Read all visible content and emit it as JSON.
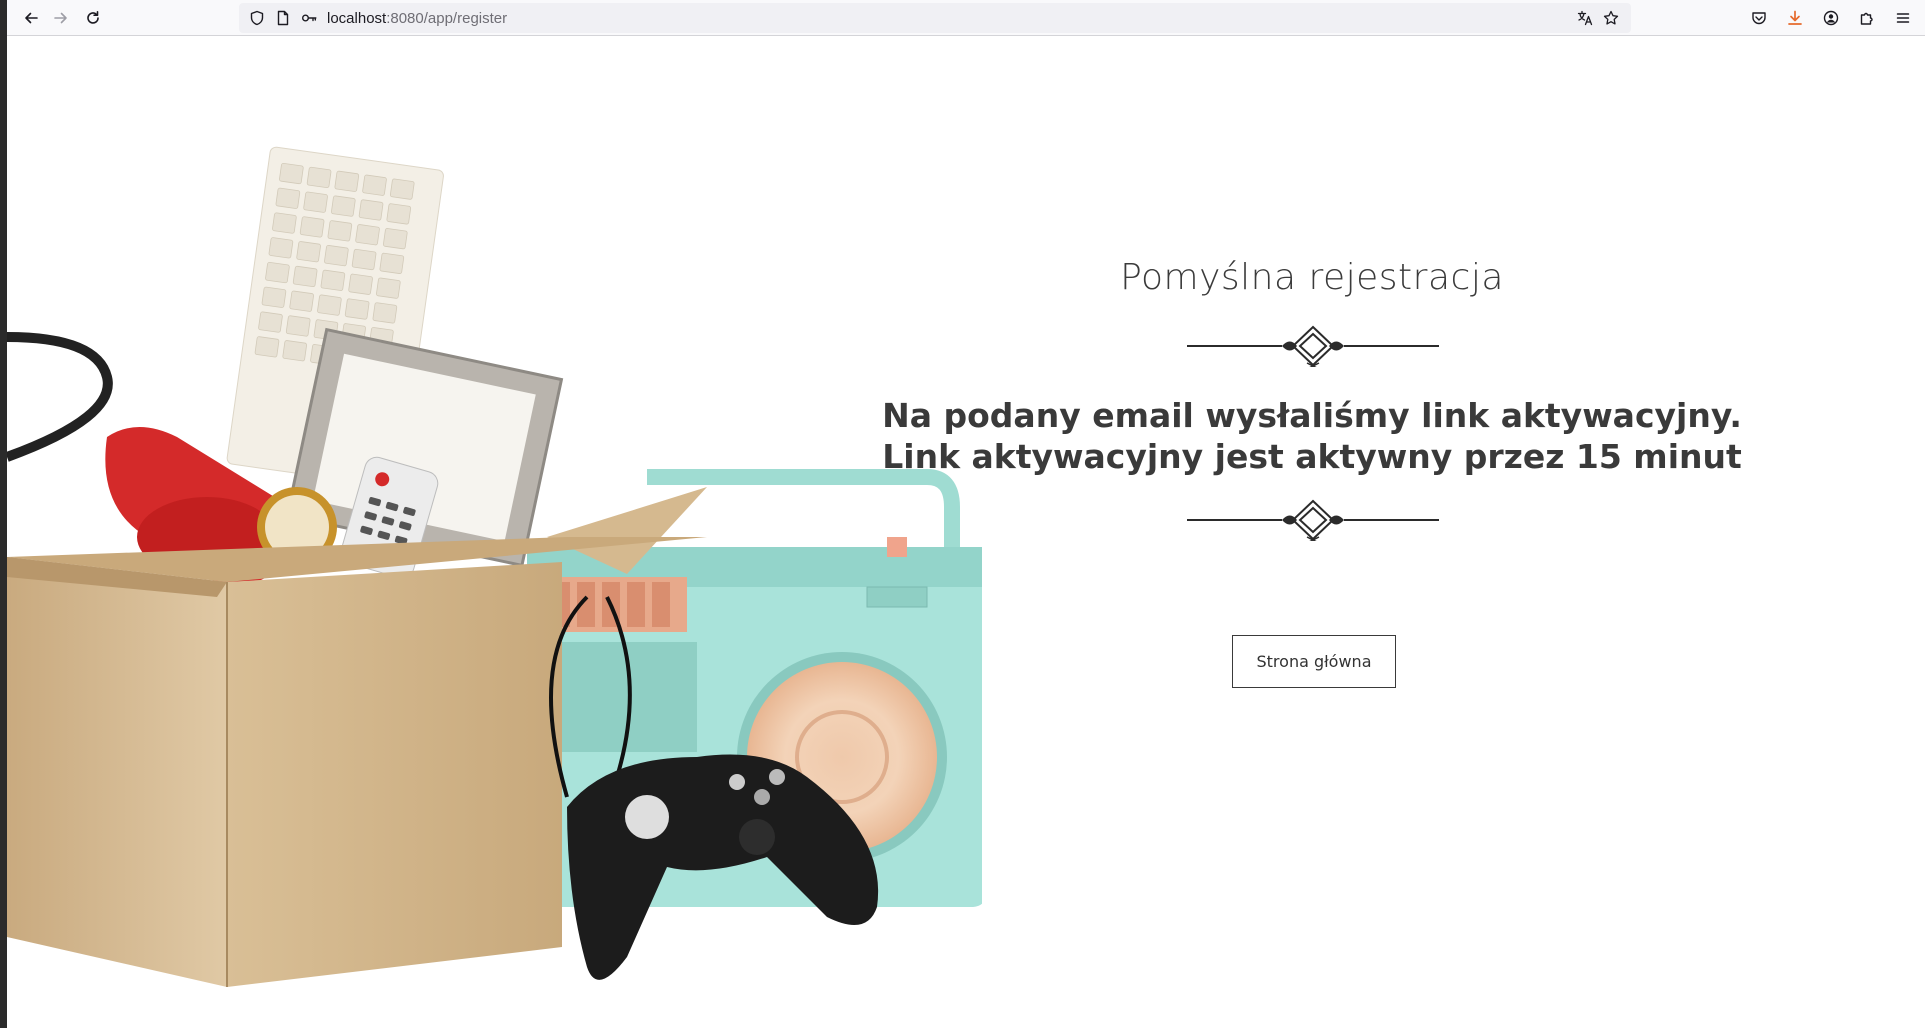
{
  "browser": {
    "url_host": "localhost",
    "url_rest": ":8080/app/register",
    "icons": {
      "back": "arrow-left-icon",
      "forward": "arrow-right-icon",
      "reload": "reload-icon",
      "shield": "shield-icon",
      "page": "page-icon",
      "permissions": "key-icon",
      "translate": "translate-icon",
      "bookmark": "star-icon",
      "pocket": "pocket-icon",
      "downloads": "download-icon",
      "account": "account-icon",
      "extensions": "puzzle-icon",
      "menu": "hamburger-menu-icon"
    },
    "accent_color": "#e66a2c"
  },
  "page": {
    "title": "Pomyślna rejestracja",
    "message": "Na podany email wysłaliśmy link aktywacyjny. Link aktywacyjny jest aktywny przez 15 minut",
    "home_button_label": "Strona główna"
  }
}
